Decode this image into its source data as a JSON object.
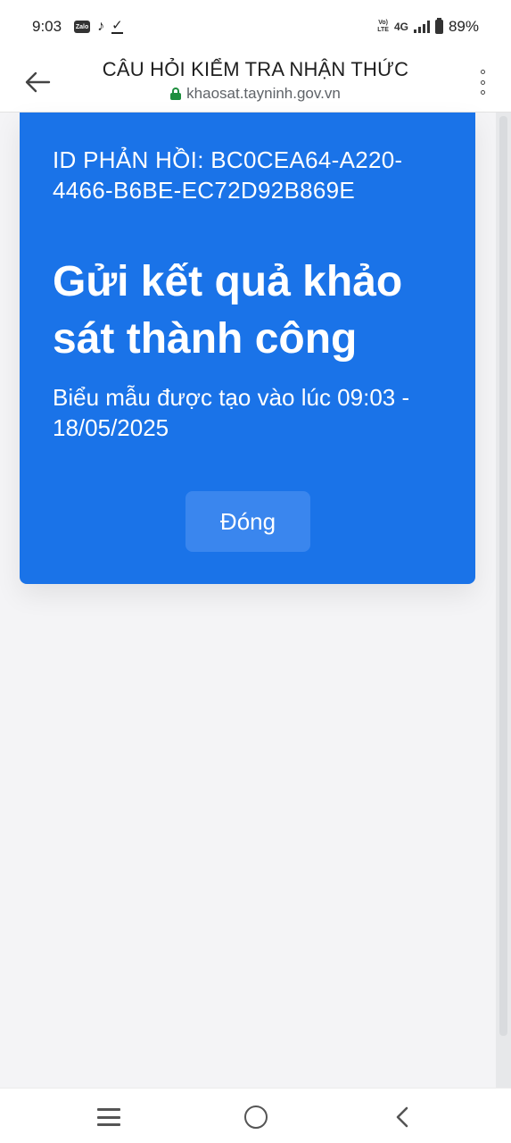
{
  "status_bar": {
    "time": "9:03",
    "zalo_label": "Zalo",
    "volte_line1": "Vo)",
    "volte_line2": "LTE",
    "network": "4G",
    "battery": "89%"
  },
  "app_bar": {
    "title": "CÂU HỎI KIỂM TRA NHẬN THỨC",
    "url": "khaosat.tayninh.gov.vn"
  },
  "card": {
    "response_id": "ID PHẢN HỒI: BC0CEA64-A220-4466-B6BE-EC72D92B869E",
    "success_title": "Gửi kết quả khảo sát thành công",
    "created_at": "Biểu mẫu được tạo vào lúc 09:03 - 18/05/2025",
    "close_label": "Đóng"
  },
  "colors": {
    "card_background": "#1a73e8",
    "button_background": "#3a86ee",
    "lock_green": "#1e8e3e"
  },
  "icons": {
    "back": "arrow-left-icon",
    "menu": "more-vertical-icon",
    "lock": "lock-icon",
    "nav_recents": "recents-icon",
    "nav_home": "home-icon",
    "nav_back": "back-chevron-icon"
  }
}
